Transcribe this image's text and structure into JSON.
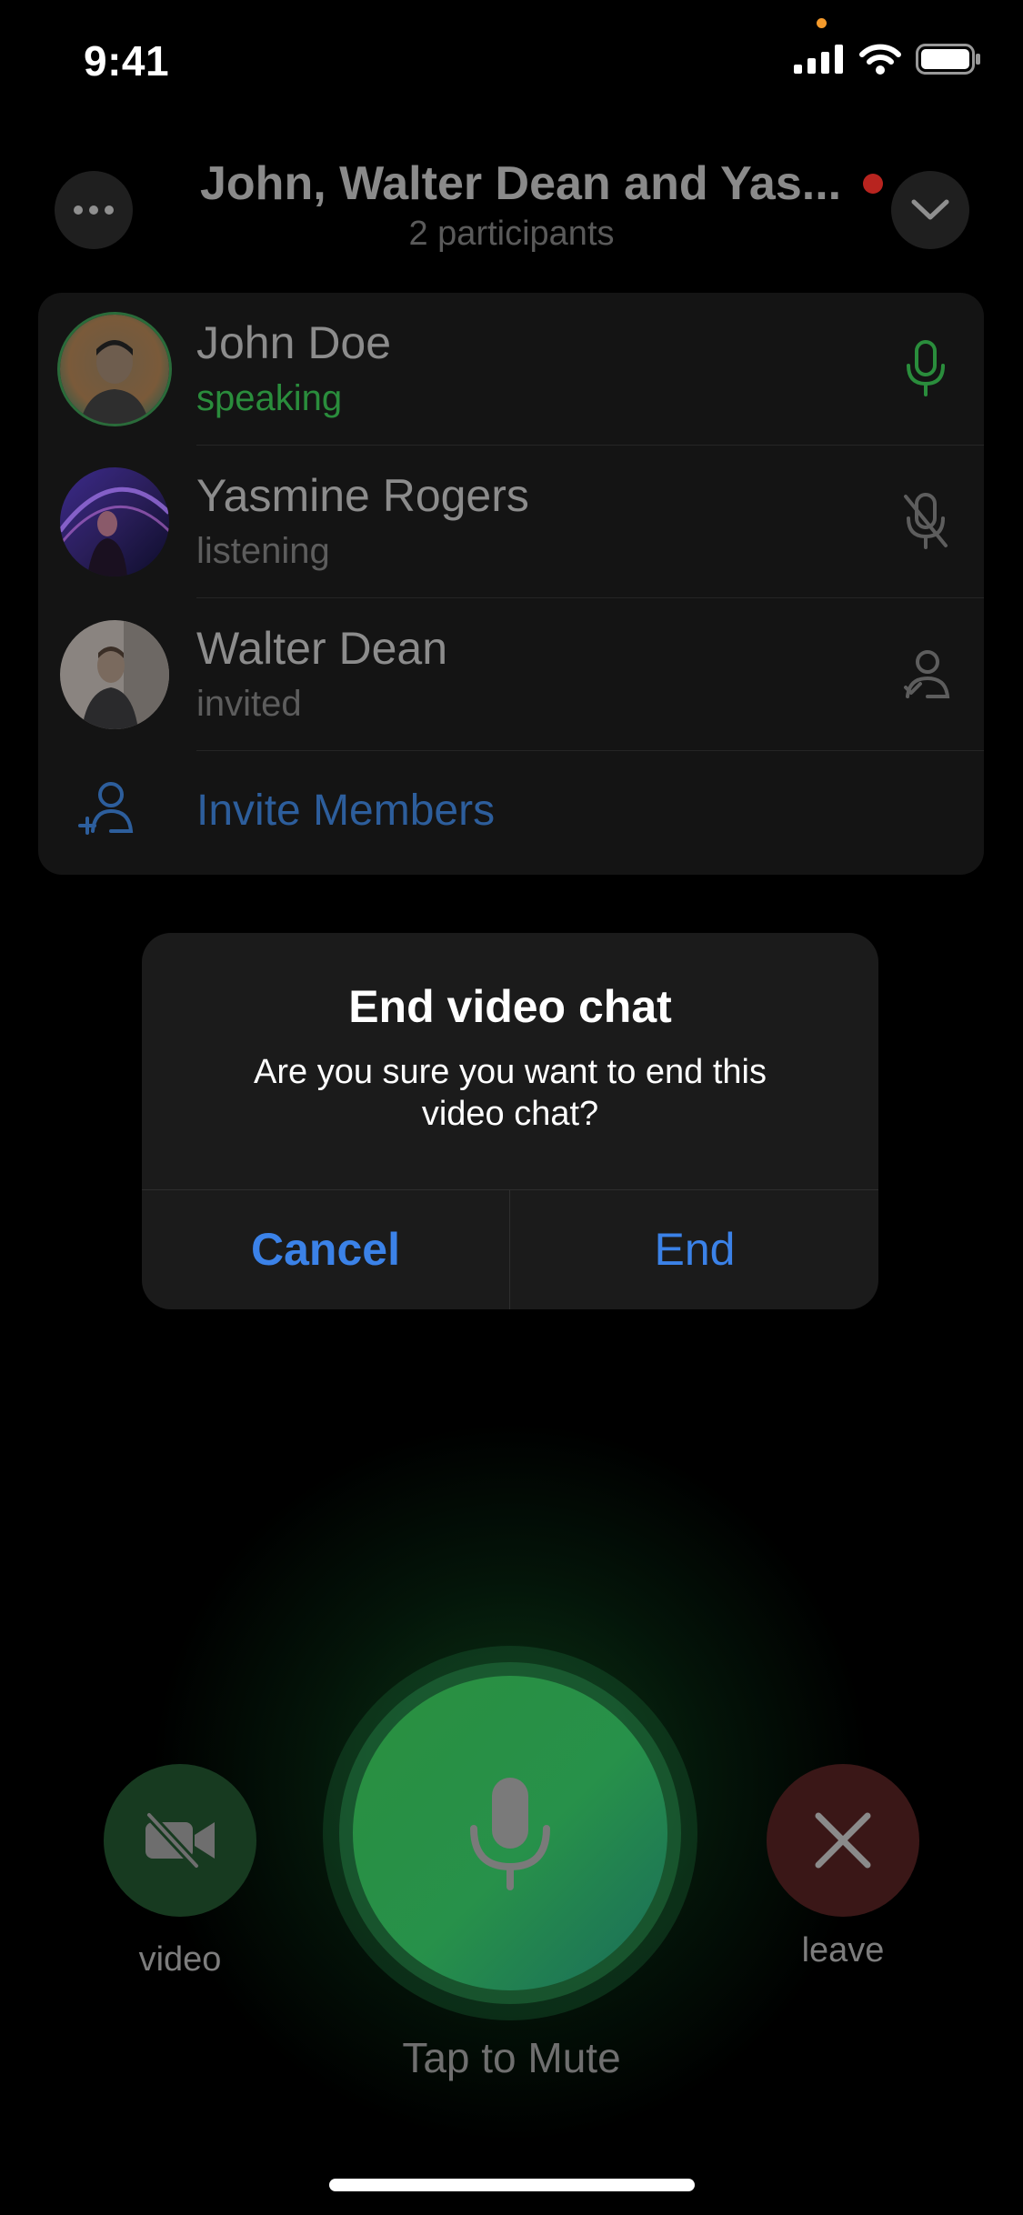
{
  "status_bar": {
    "time": "9:41"
  },
  "header": {
    "title": "John, Walter Dean and Yas...",
    "subtitle": "2 participants",
    "recording_color": "#b8241f",
    "more_icon": "ellipsis-icon",
    "collapse_icon": "chevron-down-icon"
  },
  "participants": [
    {
      "name": "John Doe",
      "status": "speaking",
      "icon": "microphone-active-icon"
    },
    {
      "name": "Yasmine Rogers",
      "status": "listening",
      "icon": "microphone-muted-icon"
    },
    {
      "name": "Walter Dean",
      "status": "invited",
      "icon": "user-invited-icon"
    }
  ],
  "invite": {
    "label": "Invite Members",
    "icon": "add-user-icon"
  },
  "dialog": {
    "title": "End video chat",
    "message": "Are you sure you want to end this video chat?",
    "cancel_label": "Cancel",
    "confirm_label": "End"
  },
  "controls": {
    "video_label": "video",
    "leave_label": "leave",
    "mic_hint": "Tap to Mute",
    "accent_green": "#2a8f3f",
    "accent_blue": "#3b82e8"
  }
}
